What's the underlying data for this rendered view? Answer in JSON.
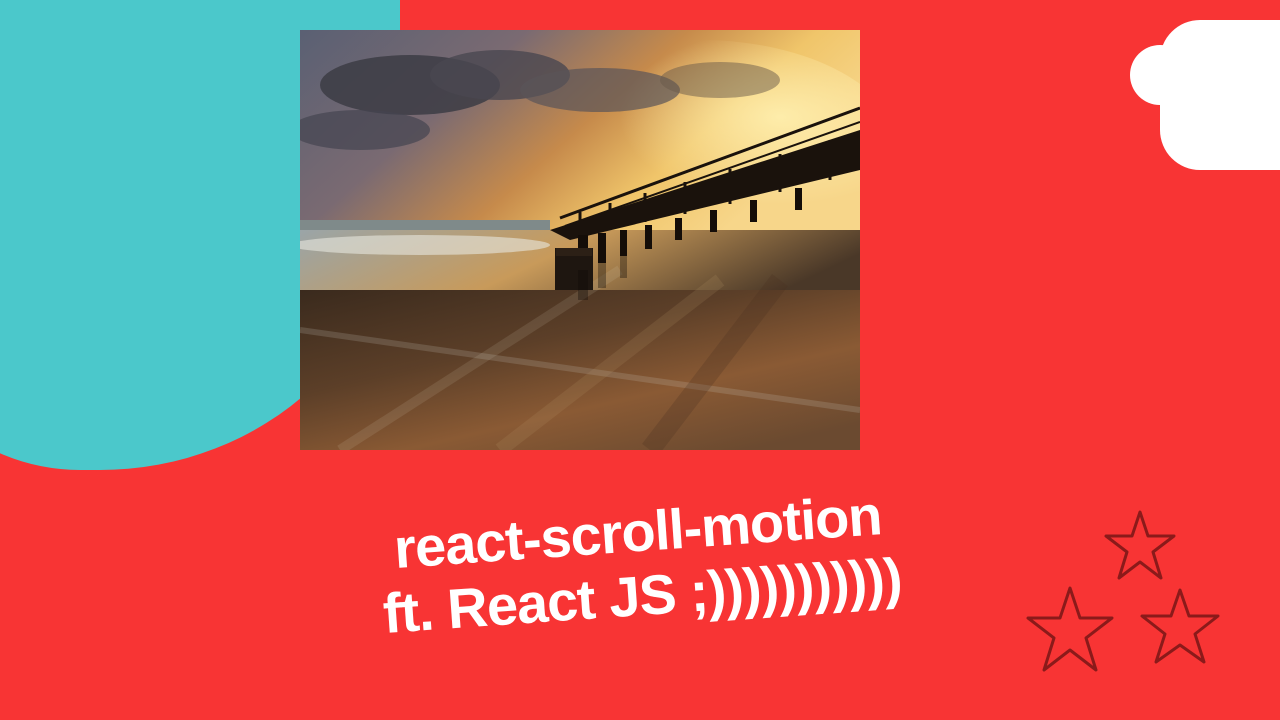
{
  "title": {
    "line1": "react-scroll-motion",
    "line2": "ft. React JS ;)))))))))))"
  },
  "icons": {
    "hero": "sunset-pier-photo",
    "decor_teal": "teal-blob",
    "decor_white": "white-cloud-shape",
    "decor_stars": "hand-drawn-stars"
  },
  "colors": {
    "background": "#f83434",
    "teal": "#4bc8cb",
    "white": "#ffffff",
    "text": "#ffffff",
    "star_stroke": "#8b1a1a"
  }
}
